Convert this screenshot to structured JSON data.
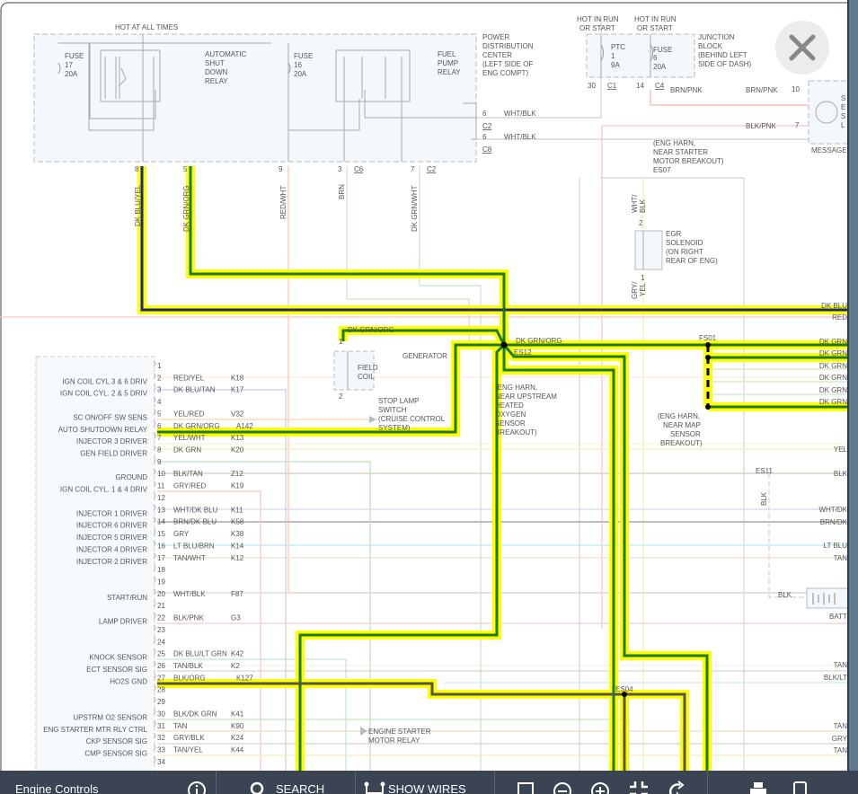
{
  "toolbar": {
    "title": "Engine Controls",
    "search_label": "SEARCH",
    "show_wires_label": "SHOW WIRES"
  },
  "pdc": {
    "hot_label": "HOT AT ALL TIMES",
    "name": [
      "POWER",
      "DISTRIBUTION",
      "CENTER",
      "(LEFT SIDE OF",
      "ENG COMPT)"
    ],
    "fuse17": [
      "FUSE",
      "17",
      "20A"
    ],
    "fuse16": [
      "FUSE",
      "16",
      "20A"
    ],
    "asd_relay": [
      "AUTOMATIC",
      "SHUT",
      "DOWN",
      "RELAY"
    ],
    "fuel_pump_relay": [
      "FUEL",
      "PUMP",
      "RELAY"
    ],
    "out_c2": {
      "pin": "6",
      "wire": "WHT/BLK",
      "conn": "C2"
    },
    "out_c8": {
      "pin": "6",
      "wire": "WHT/BLK",
      "conn": "C8"
    },
    "bottom_pins": [
      {
        "pin": "8",
        "conn": "",
        "wire": "DK BLU/YEL"
      },
      {
        "pin": "5",
        "conn": "",
        "wire": "DK GRN/ORG"
      },
      {
        "pin": "9",
        "conn": "",
        "wire": "RED/WHT"
      },
      {
        "pin": "3",
        "conn": "C6",
        "wire": "BRN"
      },
      {
        "pin": "7",
        "conn": "C2",
        "wire": "DK GRN/WHT"
      }
    ]
  },
  "junction_block": {
    "hot1": [
      "HOT IN RUN",
      "OR START"
    ],
    "hot2": [
      "HOT IN RUN",
      "OR START"
    ],
    "ptc": [
      "PTC",
      "1",
      "9A"
    ],
    "fuse6": [
      "FUSE",
      "6",
      "20A"
    ],
    "name": [
      "JUNCTION",
      "BLOCK",
      "(BEHIND LEFT",
      "SIDE OF DASH)"
    ],
    "pin30": "30",
    "c1": "C1",
    "pin14": "14",
    "c4": "C4",
    "wire_brn_pnk_1": "BRN/PNK",
    "wire_brn_pnk_2": "BRN/PNK",
    "pin10": "10",
    "wire_blk_pnk": "BLK/PNK",
    "pin7": "7",
    "message_center": "MESSAGE",
    "message_lamp_partial": [
      "S",
      "E",
      "S",
      "L"
    ]
  },
  "splices": {
    "es07": [
      "(ENG HARN,",
      "NEAR STARTER",
      "MOTOR BREAKOUT)",
      "ES07"
    ],
    "es12": "ES12",
    "es12_note": [
      "(ENG HARN,",
      "NEAR UPSTREAM",
      "HEATED",
      "OXYGEN",
      "SENSOR",
      "BREAKOUT)"
    ],
    "fs01": "FS01",
    "fs01_note": [
      "(ENG HARN,",
      "NEAR MAP",
      "SENSOR",
      "BREAKOUT)"
    ],
    "es11": "ES11",
    "es04": "ES04"
  },
  "egr": {
    "name": [
      "EGR",
      "SOLENOID",
      "(ON RIGHT",
      "REAR OF ENG)"
    ],
    "wire_top": [
      "WHT/",
      "BLK"
    ],
    "wire_bottom": [
      "GRY/",
      "YEL"
    ],
    "pin2": "2",
    "pin1": "1"
  },
  "generator": {
    "name": "GENERATOR",
    "coil": [
      "FIELD",
      "COIL"
    ],
    "wire": "DK GRN/ORG",
    "pin1": "1",
    "pin2": "2"
  },
  "es12_wire": "DK GRN/ORG",
  "stop_lamp": [
    "STOP LAMP",
    "SWITCH",
    "(CRUISE CONTROL",
    "SYSTEM)"
  ],
  "starter_relay": [
    "ENGINE STARTER",
    "MOTOR RELAY"
  ],
  "battery": {
    "wire": "BLK",
    "label": "BATT",
    "es11_wire": "BLK"
  },
  "right_labels": [
    "DK BLU",
    "RED",
    "DK GRN",
    "DK GRN",
    "DK GRN",
    "DK GRN",
    "DK GRN",
    "DK GRN",
    "YEL",
    "BLK",
    "WHT/DK",
    "BRN/DK",
    "LT BLU",
    "TAN",
    "TAN",
    "BLK/LT",
    "TAN",
    "GRY",
    "TAN"
  ],
  "pcm_pins": [
    {
      "pin": "1"
    },
    {
      "pin": "2",
      "func": "IGN COIL CYL 3 & 6 DRIV",
      "wire": "RED/YEL",
      "code": "K18",
      "color": "#f6c6ae"
    },
    {
      "pin": "3",
      "func": "IGN COIL CYL. 2 & 5 DRIV",
      "wire": "DK BLU/TAN",
      "code": "K17",
      "color": "#c9cde6"
    },
    {
      "pin": "4"
    },
    {
      "pin": "5",
      "func": "SC ON/OFF SW SENS",
      "wire": "YEL/RED",
      "code": "V32",
      "color": "#f8d7b0"
    },
    {
      "pin": "6",
      "func": "AUTO SHUTDOWN RELAY",
      "wire": "DK GRN/ORG",
      "code": "A142",
      "color": "#1b7a1b"
    },
    {
      "pin": "7",
      "func": "INJECTOR 3 DRIVER",
      "wire": "YEL/WHT",
      "code": "K13",
      "color": "#f4f1b0"
    },
    {
      "pin": "8",
      "func": "GEN FIELD DRIVER",
      "wire": "DK GRN",
      "code": "K20",
      "color": "#bfe0c0"
    },
    {
      "pin": "9"
    },
    {
      "pin": "10",
      "func": "GROUND",
      "wire": "BLK/TAN",
      "code": "Z12",
      "color": "#cfcac0"
    },
    {
      "pin": "11",
      "func": "IGN COIL CYL. 1 & 4 DRIV",
      "wire": "GRY/RED",
      "code": "K19",
      "color": "#f0c8c8"
    },
    {
      "pin": "12"
    },
    {
      "pin": "13",
      "func": "INJECTOR 1 DRIVER",
      "wire": "WHT/DK BLU",
      "code": "K11",
      "color": "#d4d8ee"
    },
    {
      "pin": "14",
      "func": "INJECTOR 6 DRIVER",
      "wire": "BRN/DK BLU",
      "code": "K58",
      "color": "#bdbdbd"
    },
    {
      "pin": "15",
      "func": "INJECTOR 5 DRIVER",
      "wire": "GRY",
      "code": "K38",
      "color": "#e6e6e6"
    },
    {
      "pin": "16",
      "func": "INJECTOR 4 DRIVER",
      "wire": "LT BLU/BRN",
      "code": "K14",
      "color": "#bfeaea"
    },
    {
      "pin": "17",
      "func": "INJECTOR 2 DRIVER",
      "wire": "TAN/WHT",
      "code": "K12",
      "color": "#ebe2cc"
    },
    {
      "pin": "18"
    },
    {
      "pin": "19"
    },
    {
      "pin": "20",
      "func": "START/RUN",
      "wire": "WHT/BLK",
      "code": "F87",
      "color": "#d6d6d6"
    },
    {
      "pin": "21"
    },
    {
      "pin": "22",
      "func": "LAMP DRIVER",
      "wire": "BLK/PNK",
      "code": "G3",
      "color": "#efcfcf"
    },
    {
      "pin": "23"
    },
    {
      "pin": "24"
    },
    {
      "pin": "25",
      "func": "KNOCK SENSOR",
      "wire": "DK BLU/LT GRN",
      "code": "K42",
      "color": "#bfe6d0"
    },
    {
      "pin": "26",
      "func": "ECT SENSOR SIG",
      "wire": "TAN/BLK",
      "code": "K2",
      "color": "#ddd5c5"
    },
    {
      "pin": "27",
      "func": "HO2S GND",
      "wire": "BLK/ORG",
      "code": "K127",
      "color": "#555555"
    },
    {
      "pin": "28"
    },
    {
      "pin": "29"
    },
    {
      "pin": "30",
      "func": "UPSTRM O2 SENSOR",
      "wire": "BLK/DK GRN",
      "code": "K41",
      "color": "#c6e2c6"
    },
    {
      "pin": "31",
      "func": "ENG STARTER MTR RLY CTRL",
      "wire": "TAN",
      "code": "K90",
      "color": "#e8dfca"
    },
    {
      "pin": "32",
      "func": "CKP SENSOR SIG",
      "wire": "GRY/BLK",
      "code": "K24",
      "color": "#d2d2d2"
    },
    {
      "pin": "33",
      "func": "CMP SENSOR SIG",
      "wire": "TAN/YEL",
      "code": "K44",
      "color": "#f4ecb8"
    },
    {
      "pin": "34"
    }
  ],
  "colors": {
    "highlight": "#ffff00",
    "dk_blu": "#1a2a80",
    "dk_grn": "#1b7a1b",
    "ho2s_gnd": "#555555",
    "toolbar": "#3b4453"
  }
}
